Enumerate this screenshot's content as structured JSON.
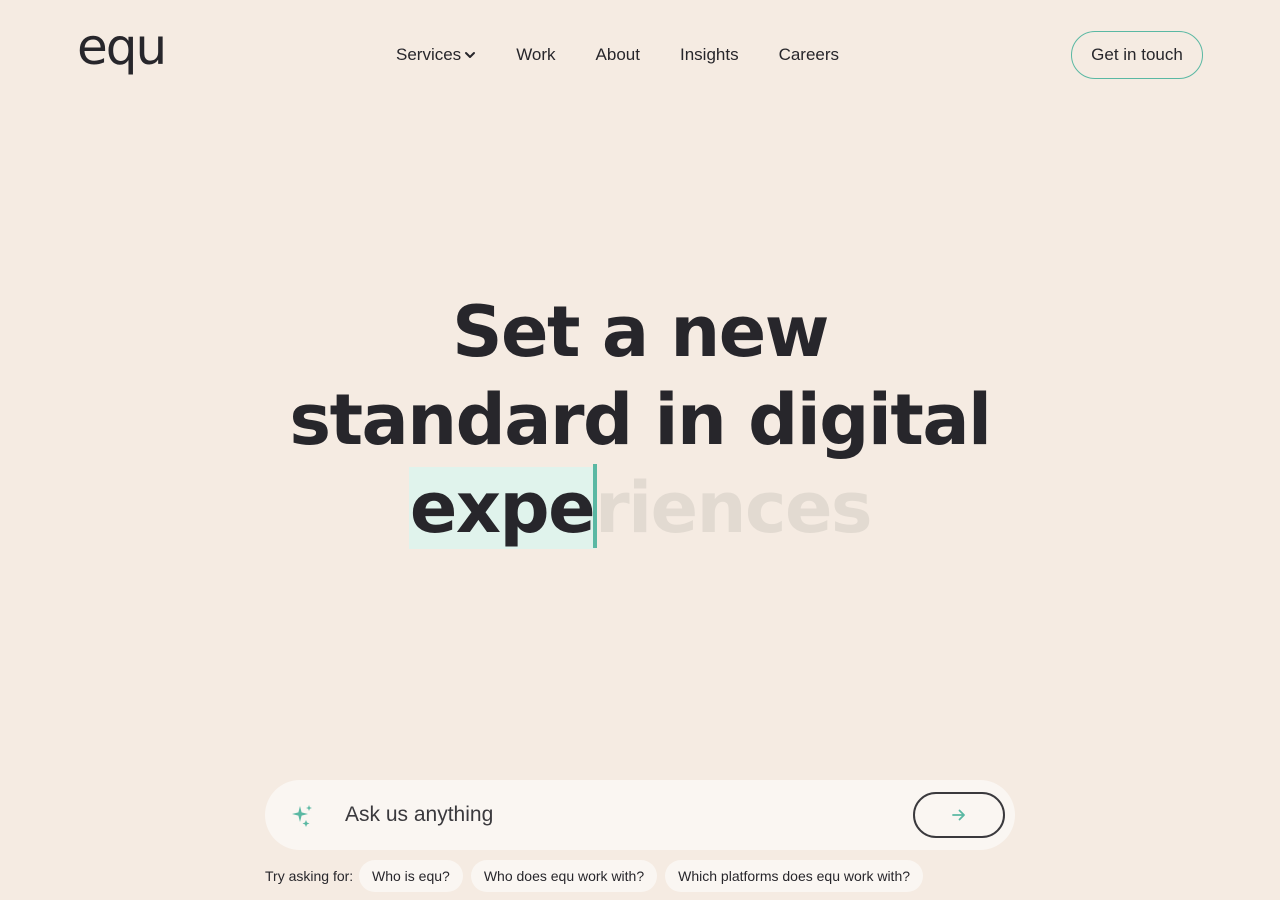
{
  "header": {
    "logo": "equ",
    "nav": [
      {
        "label": "Services",
        "has_dropdown": true
      },
      {
        "label": "Work"
      },
      {
        "label": "About"
      },
      {
        "label": "Insights"
      },
      {
        "label": "Careers"
      }
    ],
    "cta_label": "Get in touch"
  },
  "hero": {
    "line1": "Set a new",
    "line2": "standard in digital",
    "typed": "expe",
    "ghost": "riences"
  },
  "ask": {
    "placeholder": "Ask us anything",
    "icon": "sparkle-icon",
    "send_icon": "arrow-right-icon"
  },
  "suggestions": {
    "label": "Try asking for:",
    "items": [
      "Who is equ?",
      "Who does equ work with?",
      "Which platforms does equ work with?"
    ]
  },
  "colors": {
    "background": "#f5ebe2",
    "accent": "#5ab8a3",
    "text": "#27262b",
    "highlight": "#e0f3ec"
  }
}
